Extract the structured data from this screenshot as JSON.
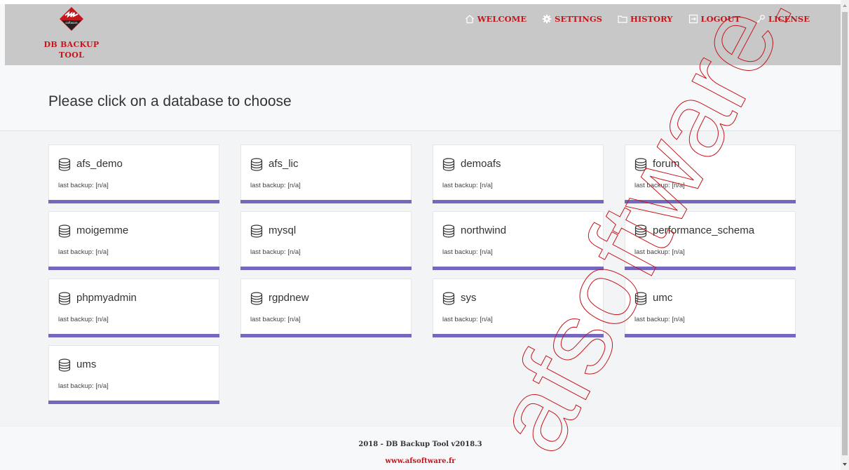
{
  "app": {
    "logo_small_text": "software",
    "logo_line1": "DB BACKUP",
    "logo_line2": "TOOL"
  },
  "menu": [
    {
      "label": "WELCOME",
      "icon": "home-icon"
    },
    {
      "label": "SETTINGS",
      "icon": "gear-icon"
    },
    {
      "label": "HISTORY",
      "icon": "folder-icon"
    },
    {
      "label": "LOGOUT",
      "icon": "logout-icon"
    },
    {
      "label": "LICENSE",
      "icon": "key-icon"
    }
  ],
  "page_title": "Please click on a database to choose",
  "databases": [
    {
      "name": "afs_demo",
      "last_backup": "last backup: [n/a]"
    },
    {
      "name": "afs_lic",
      "last_backup": "last backup: [n/a]"
    },
    {
      "name": "demoafs",
      "last_backup": "last backup: [n/a]"
    },
    {
      "name": "forum",
      "last_backup": "last backup: [n/a]"
    },
    {
      "name": "moigemme",
      "last_backup": "last backup: [n/a]"
    },
    {
      "name": "mysql",
      "last_backup": "last backup: [n/a]"
    },
    {
      "name": "northwind",
      "last_backup": "last backup: [n/a]"
    },
    {
      "name": "performance_schema",
      "last_backup": "last backup: [n/a]"
    },
    {
      "name": "phpmyadmin",
      "last_backup": "last backup: [n/a]"
    },
    {
      "name": "rgpdnew",
      "last_backup": "last backup: [n/a]"
    },
    {
      "name": "sys",
      "last_backup": "last backup: [n/a]"
    },
    {
      "name": "umc",
      "last_backup": "last backup: [n/a]"
    },
    {
      "name": "ums",
      "last_backup": "last backup: [n/a]"
    }
  ],
  "footer": {
    "line1": "2018 - DB Backup Tool v2018.3",
    "link": "www.afsoftware.fr"
  },
  "watermark": "afsoftware.fr",
  "colors": {
    "brand_red": "#c4161c",
    "card_accent": "#7367c0",
    "navbar_bg": "#c8c8c8"
  }
}
